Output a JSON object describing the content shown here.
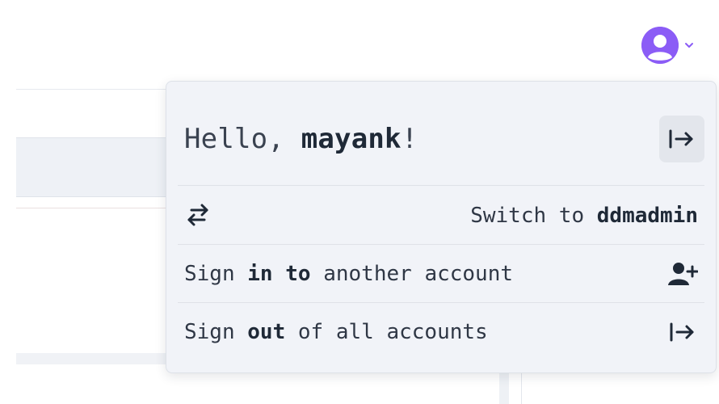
{
  "user_menu": {
    "avatar_icon": "user-circle-icon",
    "chevron_icon": "chevron-down-icon",
    "accent_color": "#8b5cf6"
  },
  "dropdown": {
    "greeting": {
      "prefix": "Hello, ",
      "username": "mayank",
      "suffix": "!"
    },
    "logout_icon": "logout-arrow-icon",
    "switch_account": {
      "icon": "switch-arrows-icon",
      "prefix": "Switch to ",
      "account": "ddmadmin"
    },
    "sign_in_another": {
      "part1": "Sign ",
      "bold": "in to",
      "part2": " another account",
      "icon": "user-plus-icon"
    },
    "sign_out_all": {
      "part1": "Sign ",
      "bold": "out",
      "part2": " of all accounts",
      "icon": "logout-arrow-icon"
    }
  }
}
